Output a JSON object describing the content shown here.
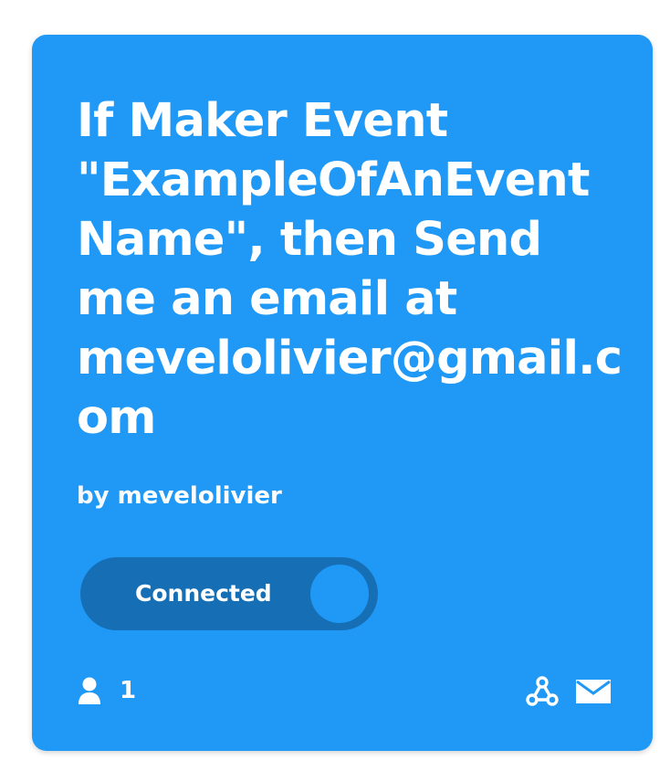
{
  "applet": {
    "title": "If Maker Event \"ExampleOfAnEventName\", then Send me an email at mevelolivier@gmail.com",
    "by_prefix": "by",
    "author": "mevelolivier",
    "toggle_label": "Connected",
    "toggle_state": "on",
    "user_count": "1"
  },
  "icons": {
    "user": "user-icon",
    "webhooks": "webhooks-icon",
    "email": "email-icon"
  },
  "colors": {
    "card_background": "#1f98f6",
    "toggle_background": "#166fb5",
    "text": "#ffffff"
  }
}
